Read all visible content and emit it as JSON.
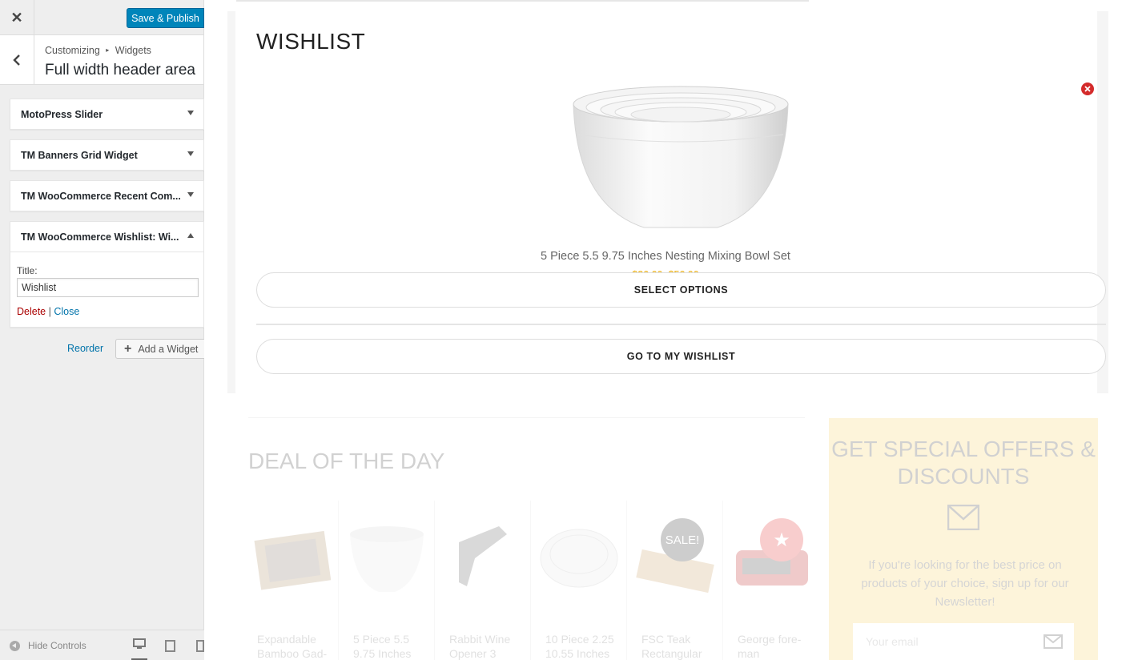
{
  "header": {
    "close_label": "✕",
    "publish_label": "Save & Publish"
  },
  "section": {
    "breadcrumb_root": "Customizing",
    "breadcrumb_sep": "▸",
    "breadcrumb_child": "Widgets",
    "title": "Full width header area"
  },
  "widgets": [
    {
      "label": "MotoPress Slider",
      "expanded": false
    },
    {
      "label": "TM Banners Grid Widget",
      "expanded": false
    },
    {
      "label": "TM WooCommerce Recent Com...",
      "expanded": false
    },
    {
      "label": "TM WooCommerce Wishlist: Wi...",
      "expanded": true
    }
  ],
  "widget_form": {
    "title_label": "Title:",
    "title_value": "Wishlist",
    "delete_label": "Delete",
    "sep": "|",
    "close_label": "Close"
  },
  "actions": {
    "reorder_label": "Reorder",
    "add_widget_label": "Add a Widget"
  },
  "footer": {
    "hide_controls_label": "Hide Controls",
    "devices": [
      "desktop-icon",
      "tablet-icon",
      "mobile-icon"
    ]
  },
  "preview": {
    "wishlist_title": "WISHLIST",
    "product_name": "5 Piece 5.5 9.75 Inches Nesting Mixing Bowl Set",
    "product_price": "$36.00–$56.00",
    "select_options_label": "SELECT OPTIONS",
    "go_to_wishlist_label": "GO TO MY WISHLIST",
    "deal_title": "DEAL OF THE DAY",
    "deal_items": [
      {
        "name": "Expandable Bamboo Gad-"
      },
      {
        "name": "5 Piece 5.5 9.75 Inches"
      },
      {
        "name": "Rabbit Wine Opener 3"
      },
      {
        "name": "10 Piece 2.25 10.55 Inches"
      },
      {
        "name": "FSC Teak Rectangular",
        "badge": "SALE!"
      },
      {
        "name": "George fore-man",
        "badge": "★"
      }
    ],
    "offers_title": "GET SPECIAL OFFERS & DISCOUNTS",
    "offers_text": "If you're looking for the best price on products of your choice, sign up for our Newsletter!",
    "email_placeholder": "Your email"
  },
  "colors": {
    "primary_button": "#0085ba",
    "link": "#0073aa",
    "delete": "#aa0000",
    "price": "#f0c040",
    "remove": "#d42b2b",
    "offers_bg": "#f7cf5b"
  }
}
